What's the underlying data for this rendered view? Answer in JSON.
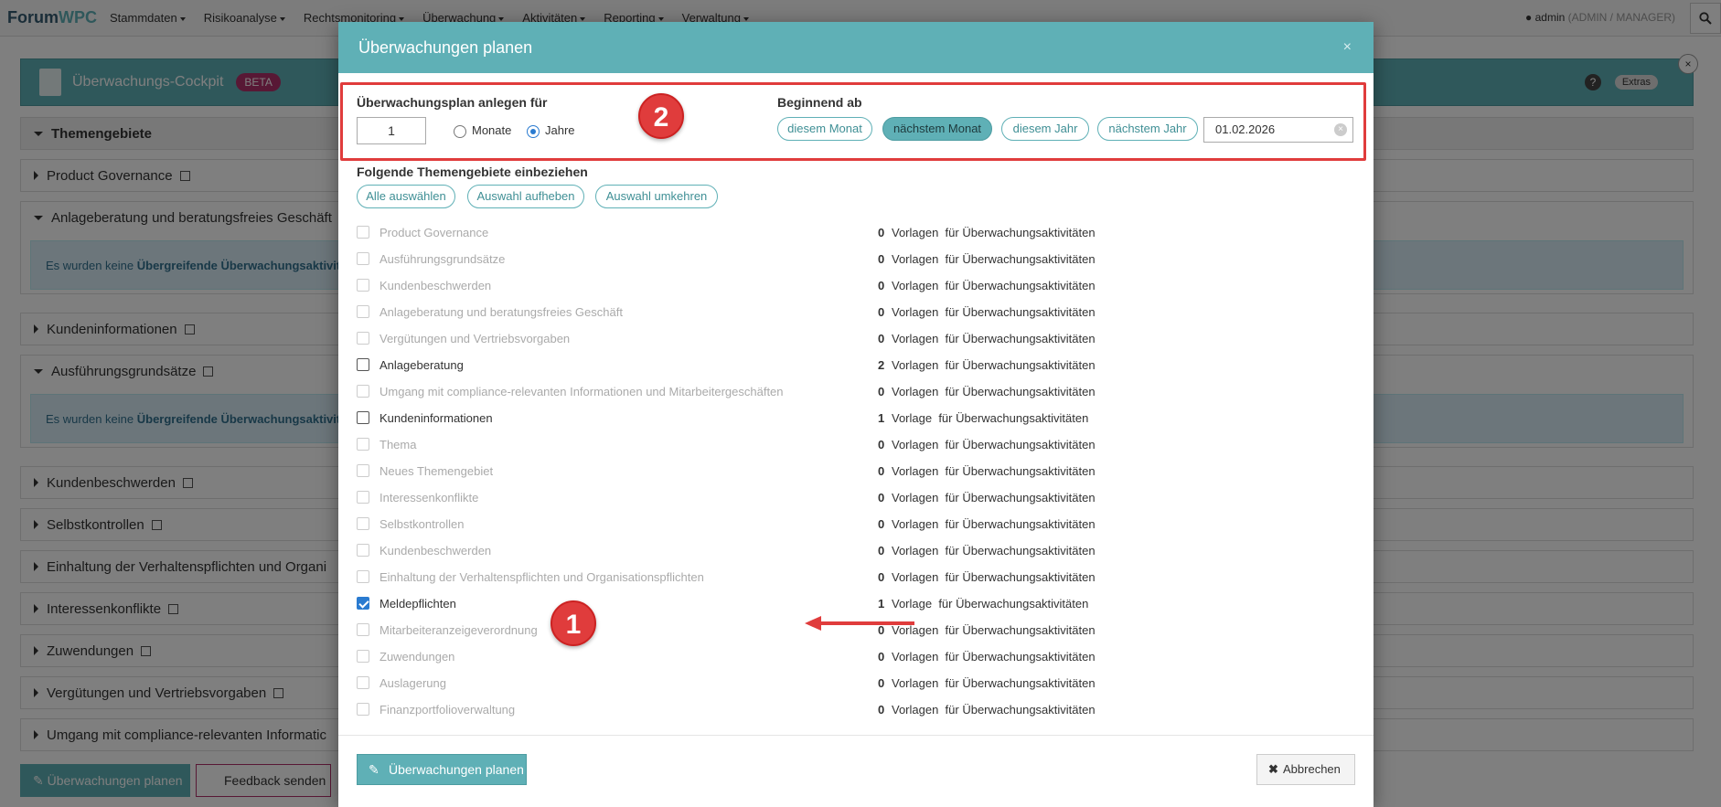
{
  "navbar": {
    "brand_part1": "Forum",
    "brand_part2": "WPC",
    "menu": [
      "Stammdaten",
      "Risikoanalyse",
      "Rechtsmonitoring",
      "Überwachung",
      "Aktivitäten",
      "Reporting",
      "Verwaltung"
    ],
    "user": "admin",
    "user_role": "(ADMIN / MANAGER)",
    "search_icon": "search-icon"
  },
  "cockpit": {
    "title": "Überwachungs-Cockpit",
    "badge": "BETA",
    "help_label": "?",
    "extras_label": "Extras"
  },
  "background_sections": {
    "themengebiete": "Themengebiete",
    "items": [
      "Product Governance",
      "Anlageberatung und beratungsfreies Geschäft",
      "Kundeninformationen",
      "Ausführungsgrundsätze",
      "Kundenbeschwerden",
      "Selbstkontrollen",
      "Einhaltung der Verhaltenspflichten und Organi",
      "Interessenkonflikte",
      "Zuwendungen",
      "Vergütungen und Vertriebsvorgaben",
      "Umgang mit compliance-relevanten Informatic"
    ],
    "info_text_prefix": "Es wurden keine ",
    "info_text_bold": "Übergreifende Überwachungsaktivit",
    "bottom_plan_button": "Überwachungen planen",
    "bottom_feedback_button": "Feedback senden"
  },
  "modal": {
    "title": "Überwachungen planen",
    "close_label": "×",
    "plan_for_label": "Überwachungsplan anlegen für",
    "plan_for_value": "1",
    "unit_months": "Monate",
    "unit_years": "Jahre",
    "selected_unit": "Jahre",
    "start_label": "Beginnend ab",
    "start_options": [
      "diesem Monat",
      "nächstem Monat",
      "diesem Jahr",
      "nächstem Jahr"
    ],
    "selected_start": "nächstem Monat",
    "start_date": "01.02.2026",
    "annotation_1": "1",
    "annotation_2": "2",
    "topics_label": "Folgende Themengebiete einbeziehen",
    "select_all": "Alle auswählen",
    "deselect": "Auswahl aufheben",
    "invert": "Auswahl umkehren",
    "topics": [
      {
        "name": "Product Governance",
        "count": "0",
        "templates": "Vorlagen  für Überwachungsaktivitäten",
        "enabled": false,
        "checked": false
      },
      {
        "name": "Ausführungsgrundsätze",
        "count": "0",
        "templates": "Vorlagen  für Überwachungsaktivitäten",
        "enabled": false,
        "checked": false
      },
      {
        "name": "Kundenbeschwerden",
        "count": "0",
        "templates": "Vorlagen  für Überwachungsaktivitäten",
        "enabled": false,
        "checked": false
      },
      {
        "name": "Anlageberatung und beratungsfreies Geschäft",
        "count": "0",
        "templates": "Vorlagen  für Überwachungsaktivitäten",
        "enabled": false,
        "checked": false
      },
      {
        "name": "Vergütungen und Vertriebsvorgaben",
        "count": "0",
        "templates": "Vorlagen  für Überwachungsaktivitäten",
        "enabled": false,
        "checked": false
      },
      {
        "name": "Anlageberatung",
        "count": "2",
        "templates": "Vorlagen  für Überwachungsaktivitäten",
        "enabled": true,
        "checked": false
      },
      {
        "name": "Umgang mit compliance-relevanten Informationen und Mitarbeitergeschäften",
        "count": "0",
        "templates": "Vorlagen  für Überwachungsaktivitäten",
        "enabled": false,
        "checked": false
      },
      {
        "name": "Kundeninformationen",
        "count": "1",
        "templates": "Vorlage  für Überwachungsaktivitäten",
        "enabled": true,
        "checked": false
      },
      {
        "name": "Thema",
        "count": "0",
        "templates": "Vorlagen  für Überwachungsaktivitäten",
        "enabled": false,
        "checked": false
      },
      {
        "name": "Neues Themengebiet",
        "count": "0",
        "templates": "Vorlagen  für Überwachungsaktivitäten",
        "enabled": false,
        "checked": false
      },
      {
        "name": "Interessenkonflikte",
        "count": "0",
        "templates": "Vorlagen  für Überwachungsaktivitäten",
        "enabled": false,
        "checked": false
      },
      {
        "name": "Selbstkontrollen",
        "count": "0",
        "templates": "Vorlagen  für Überwachungsaktivitäten",
        "enabled": false,
        "checked": false
      },
      {
        "name": "Kundenbeschwerden",
        "count": "0",
        "templates": "Vorlagen  für Überwachungsaktivitäten",
        "enabled": false,
        "checked": false
      },
      {
        "name": "Einhaltung der Verhaltenspflichten und Organisationspflichten",
        "count": "0",
        "templates": "Vorlagen  für Überwachungsaktivitäten",
        "enabled": false,
        "checked": false
      },
      {
        "name": "Meldepflichten",
        "count": "1",
        "templates": "Vorlage  für Überwachungsaktivitäten",
        "enabled": true,
        "checked": true
      },
      {
        "name": "Mitarbeiteranzeigeverordnung",
        "count": "0",
        "templates": "Vorlagen  für Überwachungsaktivitäten",
        "enabled": false,
        "checked": false
      },
      {
        "name": "Zuwendungen",
        "count": "0",
        "templates": "Vorlagen  für Überwachungsaktivitäten",
        "enabled": false,
        "checked": false
      },
      {
        "name": "Auslagerung",
        "count": "0",
        "templates": "Vorlagen  für Überwachungsaktivitäten",
        "enabled": false,
        "checked": false
      },
      {
        "name": "Finanzportfolioverwaltung",
        "count": "0",
        "templates": "Vorlagen  für Überwachungsaktivitäten",
        "enabled": false,
        "checked": false
      }
    ],
    "submit_label": "Überwachungen planen",
    "cancel_label": "Abbrechen"
  },
  "colors": {
    "teal": "#5fb0b6",
    "annotation_red": "#e03c3c",
    "beta_badge": "#b0306a",
    "checkbox_blue": "#2a7bd0"
  }
}
